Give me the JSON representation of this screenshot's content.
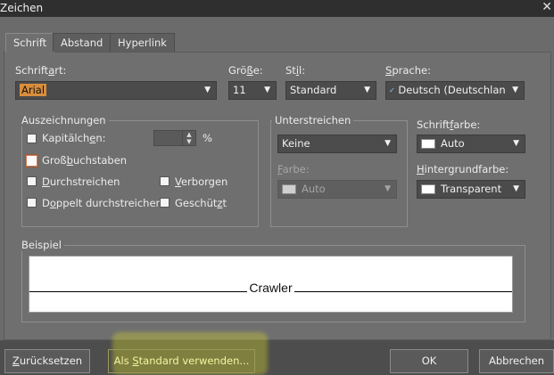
{
  "window": {
    "title": "Zeichen",
    "close_glyph": "✕"
  },
  "tabs": [
    {
      "label": "Schrift",
      "active": true
    },
    {
      "label": "Abstand",
      "active": false
    },
    {
      "label": "Hyperlink",
      "active": false
    }
  ],
  "font": {
    "family_label": "Schriftart:",
    "family_value": "Arial",
    "size_label": "Größe:",
    "size_value": "11",
    "style_label": "Stil:",
    "style_value": "Standard",
    "language_label": "Sprache:",
    "language_value": "Deutsch (Deutschlan",
    "language_icon": "spellcheck-icon"
  },
  "emphasis": {
    "title": "Auszeichnungen",
    "smallcaps": "Kapitälchen:",
    "smallcaps_unit": "%",
    "allcaps": "Großbuchstaben",
    "strikethrough": "Durchstreichen",
    "double_strike": "Doppelt durchstreichen",
    "hidden": "Verborgen",
    "protected": "Geschützt"
  },
  "underline": {
    "title": "Unterstreichen",
    "value": "Keine",
    "color_label": "Farbe:",
    "color_value": "Auto"
  },
  "font_color": {
    "label": "Schriftfarbe:",
    "value": "Auto"
  },
  "highlight_color": {
    "label": "Hintergrundfarbe:",
    "value": "Transparent"
  },
  "example": {
    "title": "Beispiel",
    "preview_text": "Crawler"
  },
  "buttons": {
    "reset": "Zurücksetzen",
    "set_default": "Als Standard verwenden...",
    "ok": "OK",
    "cancel": "Abbrechen"
  },
  "colors": {
    "highlight_yellow": "#dcdc28",
    "selection_orange": "#d98e3c",
    "dialog_bg": "#6b6b6b"
  }
}
